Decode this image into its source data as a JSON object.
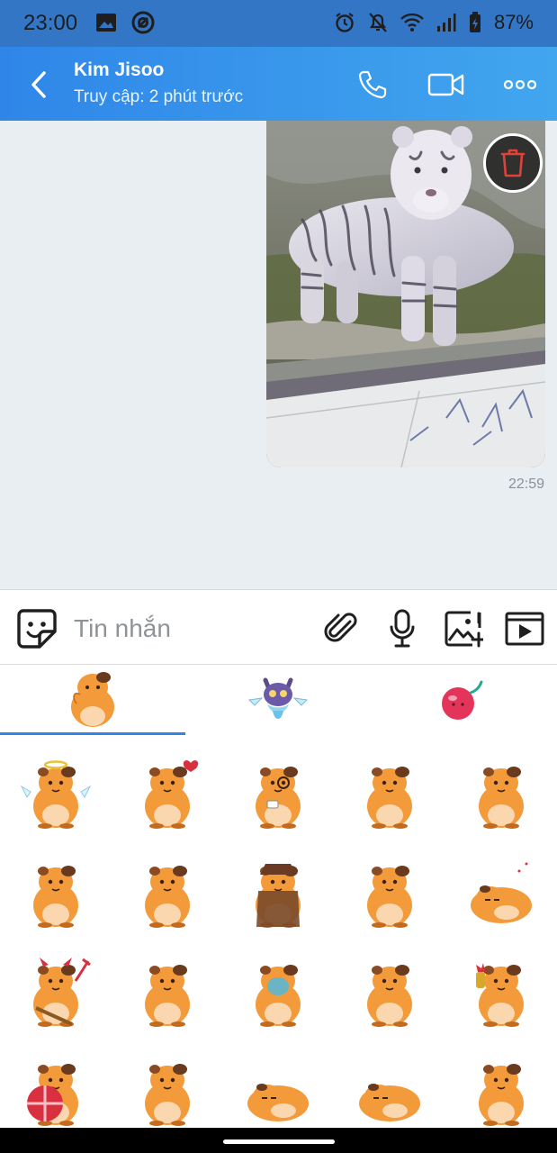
{
  "status_bar": {
    "time": "23:00",
    "battery": "87%",
    "left_icons": [
      "image-icon",
      "at-sign-icon"
    ],
    "right_icons": [
      "alarm-icon",
      "bell-off-icon",
      "wifi-icon",
      "signal-icon",
      "battery-icon"
    ]
  },
  "header": {
    "name": "Kim Jisoo",
    "status": "Truy cập: 2 phút trước",
    "icons": [
      "back-icon",
      "phone-icon",
      "video-call-icon",
      "more-icon"
    ]
  },
  "chat": {
    "messages": [
      {
        "type": "image",
        "subject": "white tiger photo",
        "time": "22:59"
      }
    ]
  },
  "input": {
    "placeholder": "Tin nhắn",
    "icons": [
      "sticker-icon",
      "paperclip-icon",
      "microphone-icon",
      "add-image-icon",
      "media-player-icon"
    ]
  },
  "sticker_panel": {
    "active_pack": 0,
    "packs": [
      "hamster",
      "ghost-cat",
      "cherry"
    ],
    "stickers": [
      "angel",
      "love-heart",
      "monocle-tea",
      "thinking",
      "shy",
      "shocked",
      "back-turned",
      "detective",
      "hands-up",
      "sleeping",
      "devil",
      "sitting-back",
      "face-mask",
      "laughing",
      "drinking",
      "gift",
      "reaching",
      "lying",
      "fallen",
      "standing"
    ]
  },
  "colors": {
    "status_bar": "#3476c6",
    "header_start": "#2f86e8",
    "header_end": "#41a6ee",
    "chat_bg": "#e9eef2",
    "accent": "#2f86e8",
    "hamster": "#f39a3a"
  }
}
